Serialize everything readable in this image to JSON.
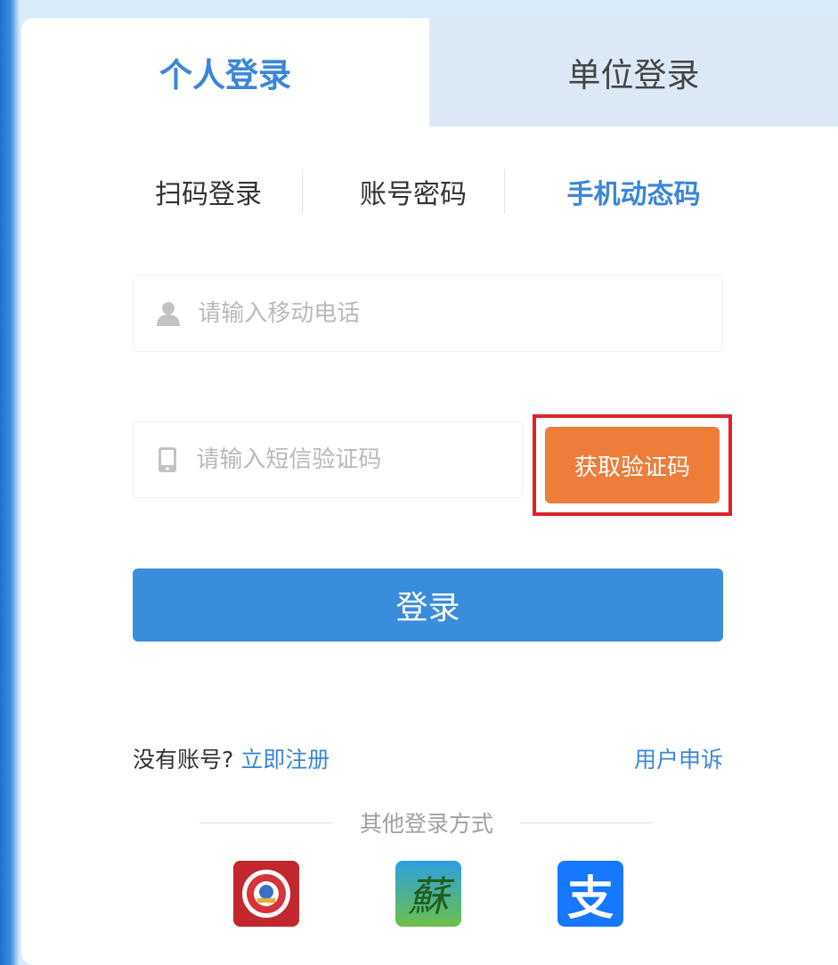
{
  "tabs": {
    "personal": "个人登录",
    "unit": "单位登录"
  },
  "sub_tabs": {
    "scan": "扫码登录",
    "account": "账号密码",
    "phone": "手机动态码",
    "active": "phone"
  },
  "phone_field": {
    "placeholder": "请输入移动电话",
    "value": ""
  },
  "code_field": {
    "placeholder": "请输入短信验证码",
    "value": ""
  },
  "get_code_button": "获取验证码",
  "login_button": "登录",
  "links": {
    "no_account": "没有账号?",
    "register": "立即注册",
    "appeal": "用户申诉"
  },
  "other_login": {
    "label": "其他登录方式",
    "icons": [
      "emblem-app-icon",
      "jiangsu-su-app-icon",
      "alipay-icon"
    ],
    "su_glyph": "蘇",
    "alipay_glyph": "支"
  },
  "colors": {
    "primary": "#3a8ddb",
    "accent_orange": "#ec7d3a",
    "highlight_red": "#e0212a"
  }
}
